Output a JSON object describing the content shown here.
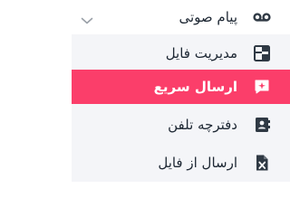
{
  "menu": {
    "group": {
      "label": "پیام صوتی",
      "icon": "voicemail-icon",
      "expand_icon": "chevron-down-icon"
    },
    "items": [
      {
        "label": "مدیریت فایل",
        "icon": "file-tree-icon",
        "active": false
      },
      {
        "label": "ارسال سریع",
        "icon": "quick-message-icon",
        "active": true
      },
      {
        "label": "دفترچه تلفن",
        "icon": "contacts-book-icon",
        "active": false
      },
      {
        "label": "ارسال از فایل",
        "icon": "excel-file-icon",
        "active": false
      }
    ]
  },
  "colors": {
    "active_background": "#fb3e6a",
    "submenu_background": "#f4f5f8",
    "text": "#1d2733",
    "icon": "#2f3944"
  }
}
